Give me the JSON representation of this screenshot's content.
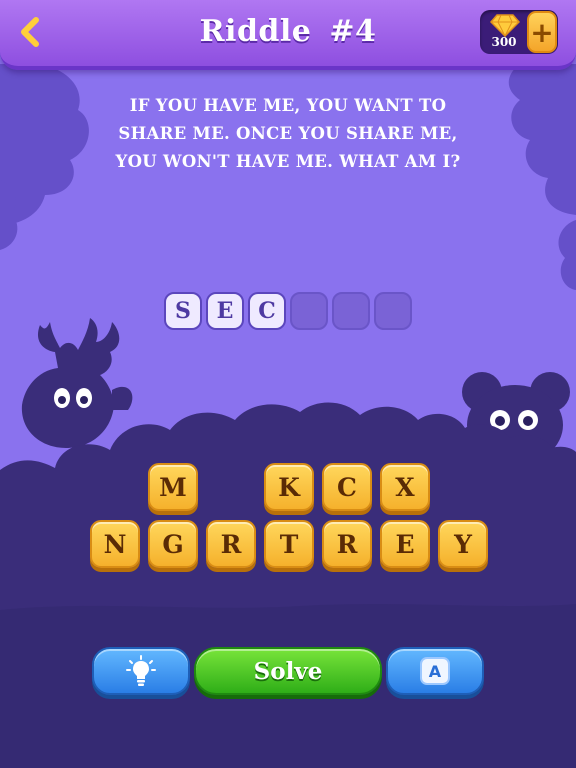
{
  "header": {
    "title": "Riddle",
    "number": "#4",
    "gems": "300",
    "plus_label": "+",
    "back_icon": "chevron-left-icon",
    "gem_icon": "diamond-icon"
  },
  "riddle": {
    "text": "If you have me, you want to share me. Once you share me, you won't have me. What am I?"
  },
  "answer": {
    "slots": [
      "S",
      "E",
      "C",
      "",
      "",
      ""
    ]
  },
  "letters": {
    "row1": [
      "M",
      "K",
      "C",
      "X"
    ],
    "row2": [
      "N",
      "G",
      "R",
      "T",
      "R",
      "E",
      "Y"
    ]
  },
  "buttons": {
    "hint_icon": "lightbulb-icon",
    "solve_label": "Solve",
    "reveal_label": "A"
  },
  "colors": {
    "background": "#8a72ee",
    "silhouette": "#3a2d7a",
    "tile": "#f5b12c",
    "solve": "#2fae18",
    "hint": "#2a7ee6"
  }
}
